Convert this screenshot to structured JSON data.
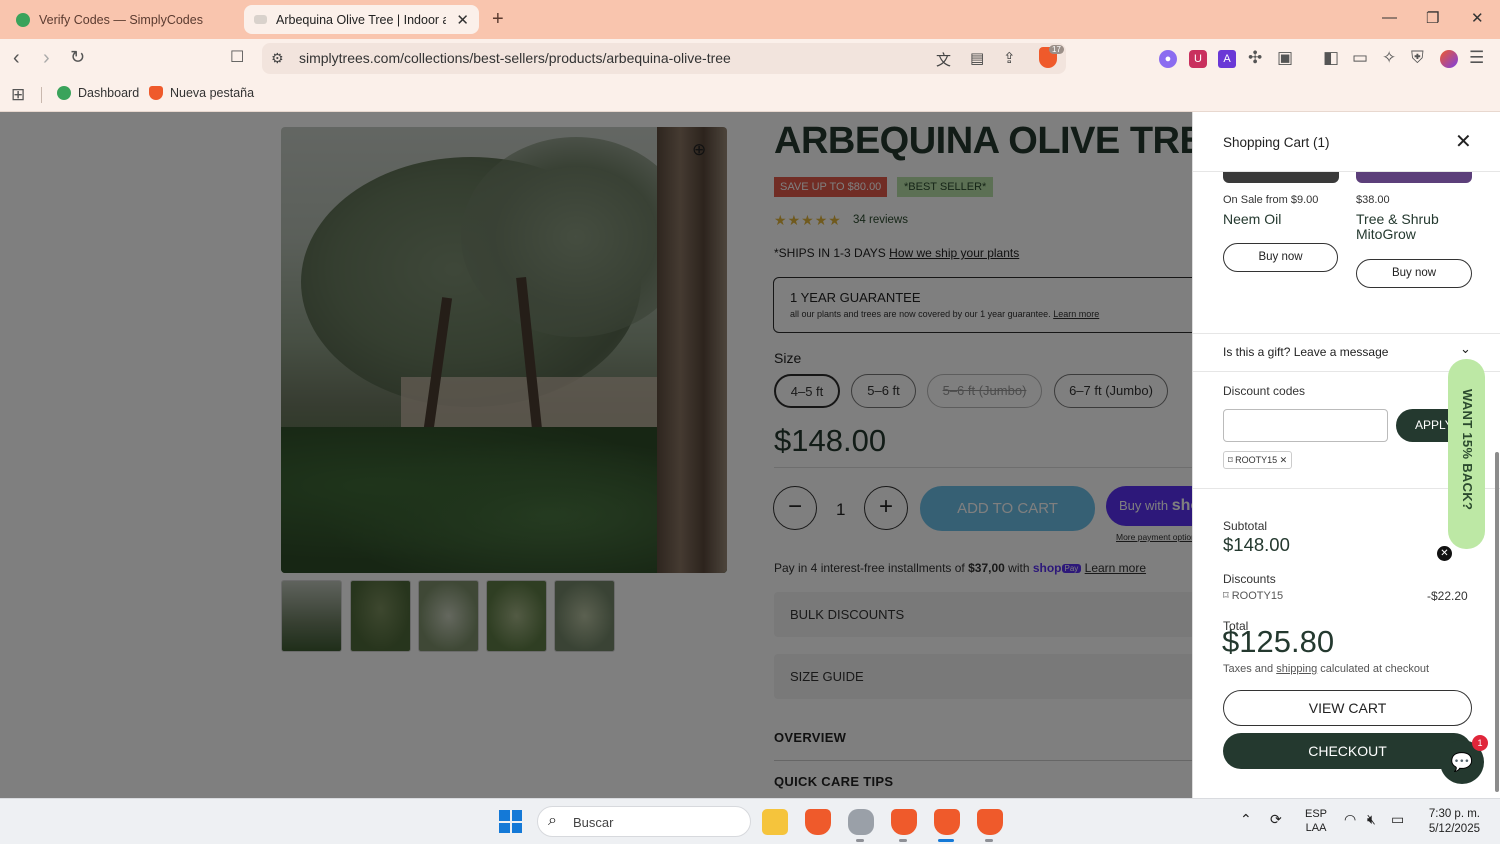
{
  "browser": {
    "tabs": [
      {
        "title": "Verify Codes — SimplyCodes"
      },
      {
        "title": "Arbequina Olive Tree | Indoor and Outdoor"
      }
    ],
    "url": "simplytrees.com/collections/best-sellers/products/arbequina-olive-tree",
    "shields_count": "17",
    "bookmarks": [
      {
        "label": "Dashboard"
      },
      {
        "label": "Nueva pestaña"
      }
    ]
  },
  "product": {
    "title": "ARBEQUINA OLIVE TREE",
    "sale_badge": "SAVE UP TO $80.00",
    "bestseller_badge": "*BEST SELLER*",
    "rating": 5,
    "reviews": "34 reviews",
    "ships_prefix": "*SHIPS IN 1-3 DAYS",
    "ships_link": "How we ship your plants",
    "guarantee_title": "1 YEAR GUARANTEE",
    "guarantee_text": "all our plants and trees are now covered by our 1 year guarantee.",
    "guarantee_link": "Learn more",
    "size_label": "Size",
    "sizes": [
      {
        "label": "4–5 ft",
        "state": "selected"
      },
      {
        "label": "5–6 ft",
        "state": "available"
      },
      {
        "label": "5–6 ft (Jumbo)",
        "state": "sold-out"
      },
      {
        "label": "6–7 ft (Jumbo)",
        "state": "available"
      }
    ],
    "price": "$148.00",
    "quantity": "1",
    "add_to_cart": "ADD TO CART",
    "shop_pay_prefix": "Buy with",
    "shop_pay_brand": "shop",
    "more_payment": "More payment options",
    "installments_prefix": "Pay in 4 interest-free installments of",
    "installments_amount": "$37,00",
    "installments_with": "with",
    "installments_brand": "shop",
    "installments_pay": "Pay",
    "installments_link": "Learn more",
    "bulk_discounts": "BULK DISCOUNTS",
    "size_guide": "SIZE GUIDE",
    "overview": "OVERVIEW",
    "care_tips": "QUICK CARE TIPS"
  },
  "cart": {
    "title": "Shopping Cart (1)",
    "upsells": [
      {
        "price": "On Sale from $9.00",
        "name": "Neem Oil",
        "button": "Buy now"
      },
      {
        "price": "$38.00",
        "name": "Tree & Shrub MitoGrow",
        "button": "Buy now"
      }
    ],
    "gift": "Is this a gift? Leave a message",
    "discount_label": "Discount codes",
    "discount_input_value": "",
    "apply": "APPLY",
    "applied_code": "ROOTY15",
    "subtotal_label": "Subtotal",
    "subtotal": "$148.00",
    "discounts_label": "Discounts",
    "discount_code": "ROOTY15",
    "discount_amount": "-$22.20",
    "total_label": "Total",
    "total": "$125.80",
    "tax_prefix": "Taxes and",
    "tax_link": "shipping",
    "tax_suffix": "calculated at checkout",
    "view_cart": "VIEW CART",
    "checkout": "CHECKOUT"
  },
  "promo": {
    "want_back": "WANT 15% BACK?"
  },
  "chat": {
    "badge": "1"
  },
  "taskbar": {
    "search_placeholder": "Buscar",
    "lang_top": "ESP",
    "lang_bottom": "LAA",
    "time": "7:30 p. m.",
    "date": "5/12/2025"
  }
}
